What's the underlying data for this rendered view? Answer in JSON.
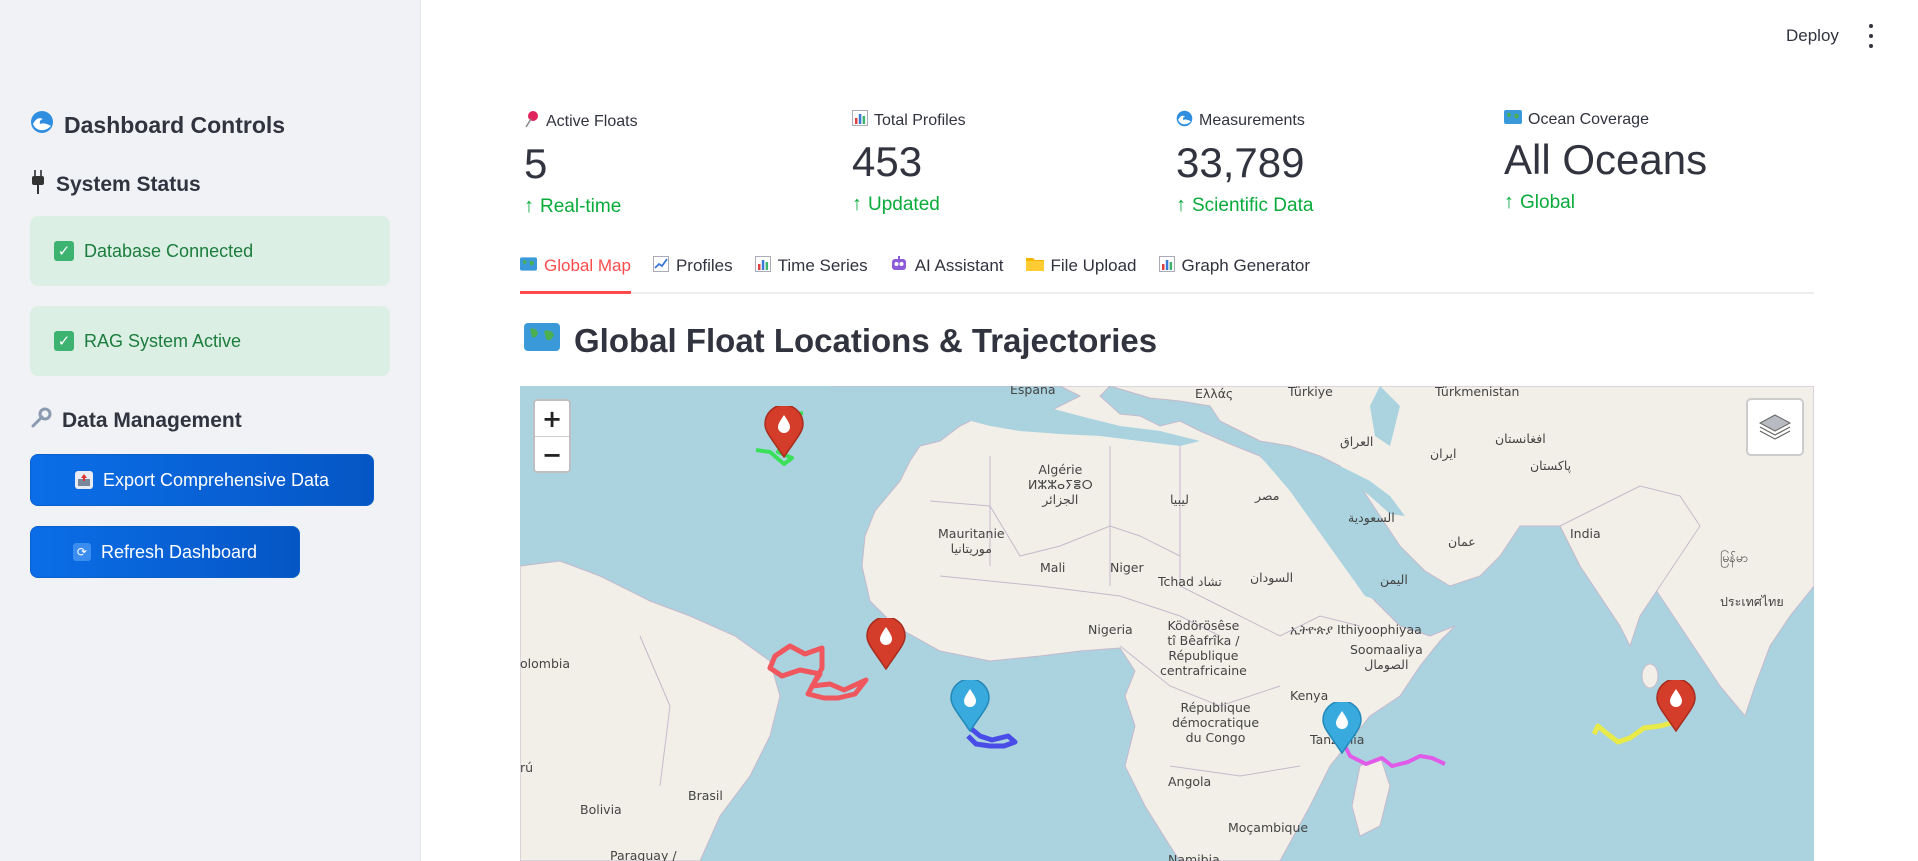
{
  "sidebar": {
    "title": "Dashboard Controls",
    "system_status_heading": "System Status",
    "statuses": [
      {
        "label": "Database Connected"
      },
      {
        "label": "RAG System Active"
      }
    ],
    "data_management_heading": "Data Management",
    "buttons": [
      {
        "label": "Export Comprehensive Data"
      },
      {
        "label": "Refresh Dashboard"
      }
    ]
  },
  "topbar": {
    "deploy_label": "Deploy"
  },
  "metrics": [
    {
      "label": "Active Floats",
      "value": "5",
      "delta": "Real-time",
      "icon": "pushpin-icon"
    },
    {
      "label": "Total Profiles",
      "value": "453",
      "delta": "Updated",
      "icon": "bar-chart-icon"
    },
    {
      "label": "Measurements",
      "value": "33,789",
      "delta": "Scientific Data",
      "icon": "wave-icon"
    },
    {
      "label": "Ocean Coverage",
      "value": "All Oceans",
      "delta": "Global",
      "icon": "world-map-icon"
    }
  ],
  "tabs": [
    {
      "label": "Global Map",
      "active": true
    },
    {
      "label": "Profiles",
      "active": false
    },
    {
      "label": "Time Series",
      "active": false
    },
    {
      "label": "AI Assistant",
      "active": false
    },
    {
      "label": "File Upload",
      "active": false
    },
    {
      "label": "Graph Generator",
      "active": false
    }
  ],
  "section_title": "Global Float Locations & Trajectories",
  "map": {
    "zoom_in": "+",
    "zoom_out": "−",
    "labels": {
      "espana": "España",
      "ellada": "Ελλάς",
      "turkiye": "Türkiye",
      "turkmenistan": "Türkmenistan",
      "afghanistan": "افغانستان",
      "iraq": "العراق",
      "iran": "ایران",
      "pakistan": "پاکستان",
      "algerie": "Algérie\nⵍⵣⵣⴰⵢⴻⵔ\nالجزائر",
      "libya": "ليبيا",
      "misr": "مصر",
      "saudi": "السعودية",
      "oman": "عمان",
      "mauritanie": "Mauritanie\nموريتانيا",
      "mali": "Mali",
      "niger": "Niger",
      "tchad": "Tchad تشاد",
      "sudan": "السودان",
      "yemen": "اليمن",
      "india": "India",
      "myanmar": "မြန်မာ",
      "thailand": "ประเทศไทย",
      "nigeria": "Nigeria",
      "centrafrique": "Ködörösêse\ntî Bêafrîka /\nRépublique\ncentrafricaine",
      "ethiopia": "ኢትዮጵያ Ithiyoophiyaa",
      "somalia": "Soomaaliya\nالصومال",
      "colombia": "olombia",
      "kenya": "Kenya",
      "rdc": "République\ndémocratique\ndu Congo",
      "tanzania": "Tanzania",
      "peru": "rú",
      "brasil": "Brasil",
      "angola": "Angola",
      "bolivia": "Bolivia",
      "mocambique": "Moçambique",
      "paraguay": "Paraguay /",
      "namibia": "Namibia"
    },
    "markers": [
      {
        "color": "#d33d29",
        "name": "float-marker-north-atlantic"
      },
      {
        "color": "#d33d29",
        "name": "float-marker-central-atlantic"
      },
      {
        "color": "#38aadd",
        "name": "float-marker-gulf-of-guinea"
      },
      {
        "color": "#38aadd",
        "name": "float-marker-east-africa"
      },
      {
        "color": "#d33d29",
        "name": "float-marker-indian-ocean"
      }
    ],
    "trajectory_colors": [
      "#3be05a",
      "#f0565d",
      "#4a4ce8",
      "#e05ce8",
      "#e8ea4a"
    ]
  }
}
